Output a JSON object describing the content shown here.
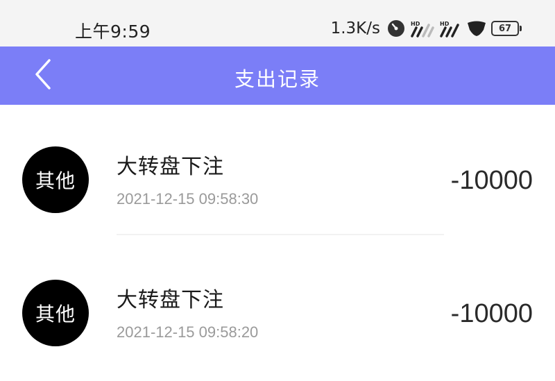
{
  "status_bar": {
    "time": "上午9:59",
    "net_speed": "1.3K/s",
    "battery_level": "67",
    "icons": [
      "speed-dial-icon",
      "hd-signal-icon",
      "hd-signal-icon",
      "shield-icon",
      "battery-icon"
    ]
  },
  "nav": {
    "title": "支出记录",
    "back_icon": "chevron-left-icon"
  },
  "records": [
    {
      "avatar_label": "其他",
      "title": "大转盘下注",
      "time": "2021-12-15 09:58:30",
      "amount": "-10000"
    },
    {
      "avatar_label": "其他",
      "title": "大转盘下注",
      "time": "2021-12-15 09:58:20",
      "amount": "-10000"
    }
  ],
  "colors": {
    "nav_bg": "#7b7ef7",
    "status_bg": "#f4f4f4",
    "avatar_bg": "#000000",
    "time_text": "#9a9a9a"
  }
}
